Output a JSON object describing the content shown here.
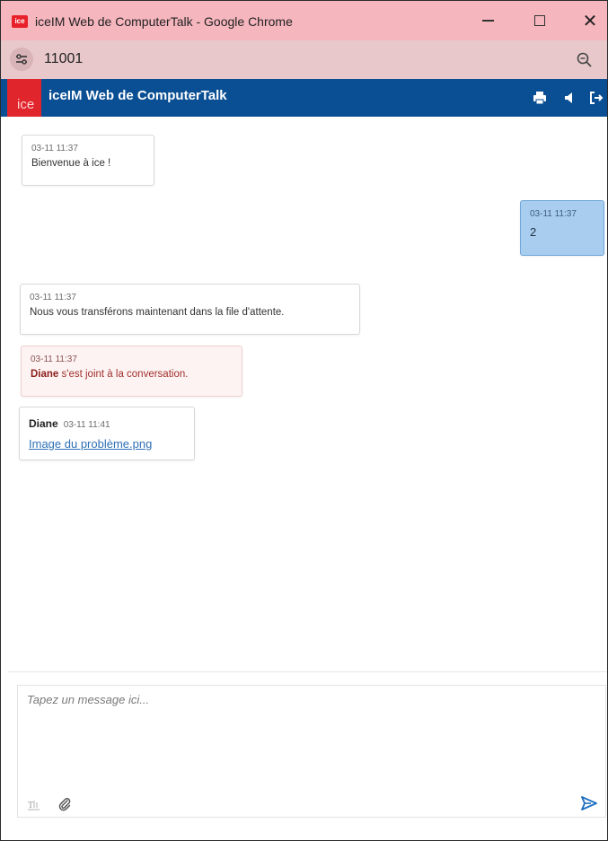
{
  "window": {
    "badge": "ice",
    "title": "iceIM Web de ComputerTalk - Google Chrome",
    "minimize_icon": "minimize-icon",
    "maximize_icon": "maximize-icon",
    "close_icon": "close-icon",
    "close_glyph": "✕"
  },
  "address_bar": {
    "url": "11001",
    "site_info_icon": "site-settings-icon",
    "zoom_icon": "zoom-icon"
  },
  "app_header": {
    "logo_text": "ice",
    "title": "iceIM Web de ComputerTalk",
    "icons": [
      "print-icon",
      "sound-icon",
      "exit-icon"
    ]
  },
  "messages": [
    {
      "timestamp": "03-11 11:37",
      "text": "Bienvenue à ice !"
    },
    {
      "timestamp": "03-11 11:37",
      "text": "2"
    },
    {
      "timestamp": "03-11 11:37",
      "text": "Nous vous transférons maintenant dans la file d'attente."
    },
    {
      "timestamp": "03-11 11:37",
      "sender": "Diane",
      "text": " s'est joint à la conversation."
    },
    {
      "timestamp": "03-11 11:41",
      "sender": "Diane",
      "link": "Image du problème.png"
    }
  ],
  "composer": {
    "placeholder": "Tapez un message ici...",
    "format_icon": "text-format-icon",
    "attach_icon": "paperclip-icon",
    "send_icon": "send-icon"
  },
  "colors": {
    "title_bar": "#f6b6be",
    "address_bar": "#e8c8cb",
    "app_header": "#0a4f93",
    "logo": "#e0252c",
    "own_message": "#a8cdef",
    "system_join_text": "#a0302c",
    "link": "#2f6fb5"
  }
}
